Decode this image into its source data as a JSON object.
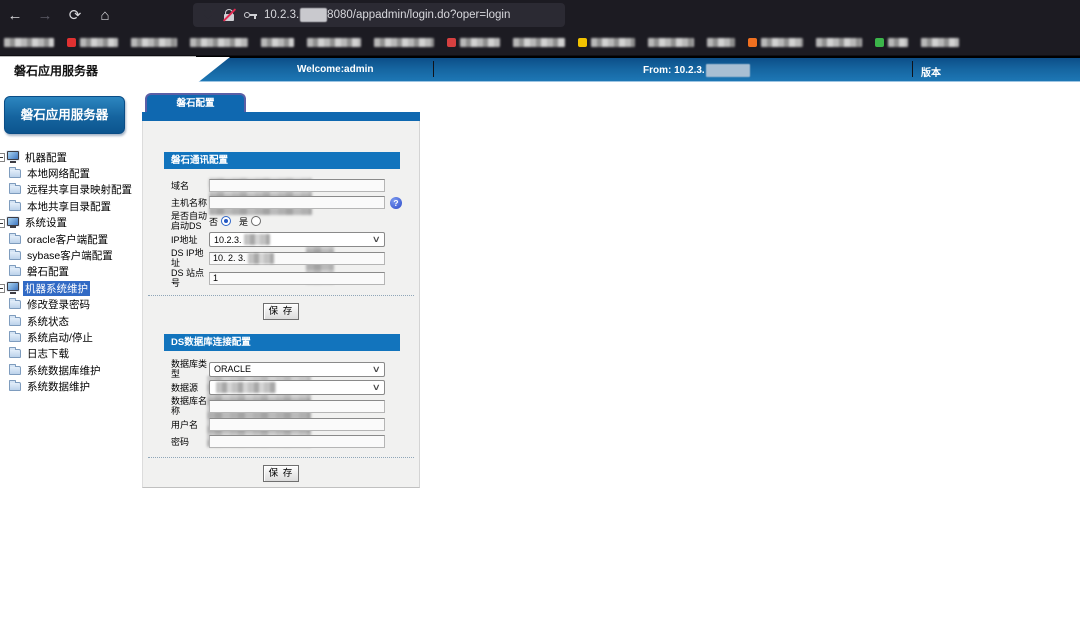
{
  "browser": {
    "url_prefix": "10.2.3.",
    "url_suffix": "8080/appadmin/login.do?oper=login",
    "nav": {
      "back": "←",
      "forward": "→",
      "reload": "⟳",
      "home": "⌂"
    }
  },
  "bookmarks": [
    {
      "favicon": null,
      "w": 50
    },
    {
      "favicon": "#e03131",
      "w": 38
    },
    {
      "favicon": null,
      "w": 46
    },
    {
      "favicon": null,
      "w": 58
    },
    {
      "favicon": null,
      "w": 33
    },
    {
      "favicon": null,
      "w": 54
    },
    {
      "favicon": null,
      "w": 60
    },
    {
      "favicon": "#d64040",
      "w": 40
    },
    {
      "favicon": null,
      "w": 52
    },
    {
      "favicon": "#f2c200",
      "w": 44
    },
    {
      "favicon": null,
      "w": 46
    },
    {
      "favicon": null,
      "w": 28
    },
    {
      "favicon": "#f07020",
      "w": 42
    },
    {
      "favicon": null,
      "w": 46
    },
    {
      "favicon": "#3bb54a",
      "w": 20
    },
    {
      "favicon": null,
      "w": 38
    }
  ],
  "app_header": {
    "title": "磐石应用服务器",
    "welcome": "Welcome:admin",
    "from_label": "From: 10.2.3.",
    "version_label": "版本"
  },
  "sidebar": {
    "title": "磐石应用服务器",
    "items": [
      {
        "label": "机器配置",
        "type": "group",
        "selected": false
      },
      {
        "label": "本地网络配置",
        "type": "leaf",
        "selected": false
      },
      {
        "label": "远程共享目录映射配置",
        "type": "leaf",
        "selected": false
      },
      {
        "label": "本地共享目录配置",
        "type": "leaf",
        "selected": false
      },
      {
        "label": "系统设置",
        "type": "group",
        "selected": false
      },
      {
        "label": "oracle客户端配置",
        "type": "leaf",
        "selected": false
      },
      {
        "label": "sybase客户端配置",
        "type": "leaf",
        "selected": false
      },
      {
        "label": "磐石配置",
        "type": "leaf",
        "selected": false
      },
      {
        "label": "机器系统维护",
        "type": "group",
        "selected": true
      },
      {
        "label": "修改登录密码",
        "type": "leaf",
        "selected": false
      },
      {
        "label": "系统状态",
        "type": "leaf",
        "selected": false
      },
      {
        "label": "系统启动/停止",
        "type": "leaf",
        "selected": false
      },
      {
        "label": "日志下载",
        "type": "leaf",
        "selected": false
      },
      {
        "label": "系统数据库维护",
        "type": "leaf",
        "selected": false
      },
      {
        "label": "系统数据维护",
        "type": "leaf",
        "selected": false
      }
    ]
  },
  "main": {
    "tab": "磐石配置",
    "sections": [
      {
        "header": "磐石通讯配置",
        "save_label": "保 存",
        "rows": [
          {
            "label": "域名",
            "type": "text",
            "value": "",
            "redacted": true
          },
          {
            "label": "主机名称",
            "type": "text",
            "value": "",
            "redacted": true,
            "help": "?"
          },
          {
            "label": "是否自动启动DS",
            "type": "radio",
            "options": [
              {
                "label": "否",
                "checked": true
              },
              {
                "label": "是",
                "checked": false
              }
            ]
          },
          {
            "label": "IP地址",
            "type": "select",
            "value": "10.2.3.",
            "redacted_suffix": true
          },
          {
            "label": "DS IP地址",
            "type": "text",
            "value": "10. 2. 3.",
            "redacted_suffix": true
          },
          {
            "label": "DS 站点号",
            "type": "text",
            "value": "1"
          }
        ]
      },
      {
        "header": "DS数据库连接配置",
        "save_label": "保 存",
        "rows": [
          {
            "label": "数据库类型",
            "type": "select",
            "value": "ORACLE"
          },
          {
            "label": "数据源",
            "type": "select",
            "value": "",
            "redacted": true
          },
          {
            "label": "数据库名称",
            "type": "text",
            "value": "",
            "redacted": true
          },
          {
            "label": "用户名",
            "type": "text",
            "value": "",
            "redacted": true
          },
          {
            "label": "密码",
            "type": "text",
            "value": "",
            "redacted": true
          }
        ]
      }
    ]
  }
}
